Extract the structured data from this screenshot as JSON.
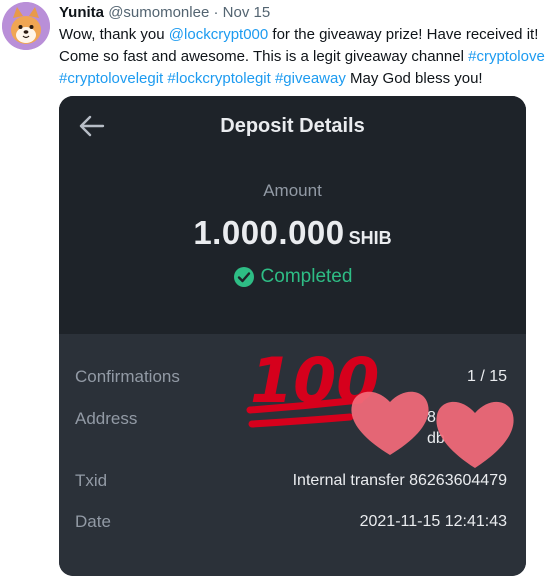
{
  "tweet": {
    "author_name": "Yunita",
    "author_handle": "@sumomonlee",
    "separator": "·",
    "date": "Nov 15",
    "text_1": "Wow, thank you ",
    "mention": "@lockcrypt000",
    "text_2": " for the giveaway prize! Have received it! Come so fast and awesome. This is a legit giveaway channel ",
    "hashtags": [
      "#cryptolove",
      "#cryptolovelegit",
      "#lockcryptolegit",
      "#giveaway"
    ],
    "text_3": " May God bless you!"
  },
  "deposit": {
    "title": "Deposit Details",
    "amount_label": "Amount",
    "amount_value": "1.000.000",
    "amount_unit": "SHIB",
    "status": "Completed",
    "confirmations_label": "Confirmations",
    "confirmations_value": "1 / 15",
    "address_label": "Address",
    "address_fragment_1": "8",
    "address_fragment_2": "db",
    "txid_label": "Txid",
    "txid_value": "Internal transfer 86263604479",
    "date_label": "Date",
    "date_value": "2021-11-15 12:41:43"
  },
  "overlay": {
    "emoji_text": "100",
    "icons": [
      "hundred-points-emoji",
      "heart-icon",
      "heart-icon"
    ]
  },
  "colors": {
    "link": "#1d9bf0",
    "panel_dark": "#1e2329",
    "panel_mid": "#2b3139",
    "completed_green": "#2ebd85",
    "emoji_red": "#d6001c",
    "heart_pink": "#f26b7a"
  }
}
